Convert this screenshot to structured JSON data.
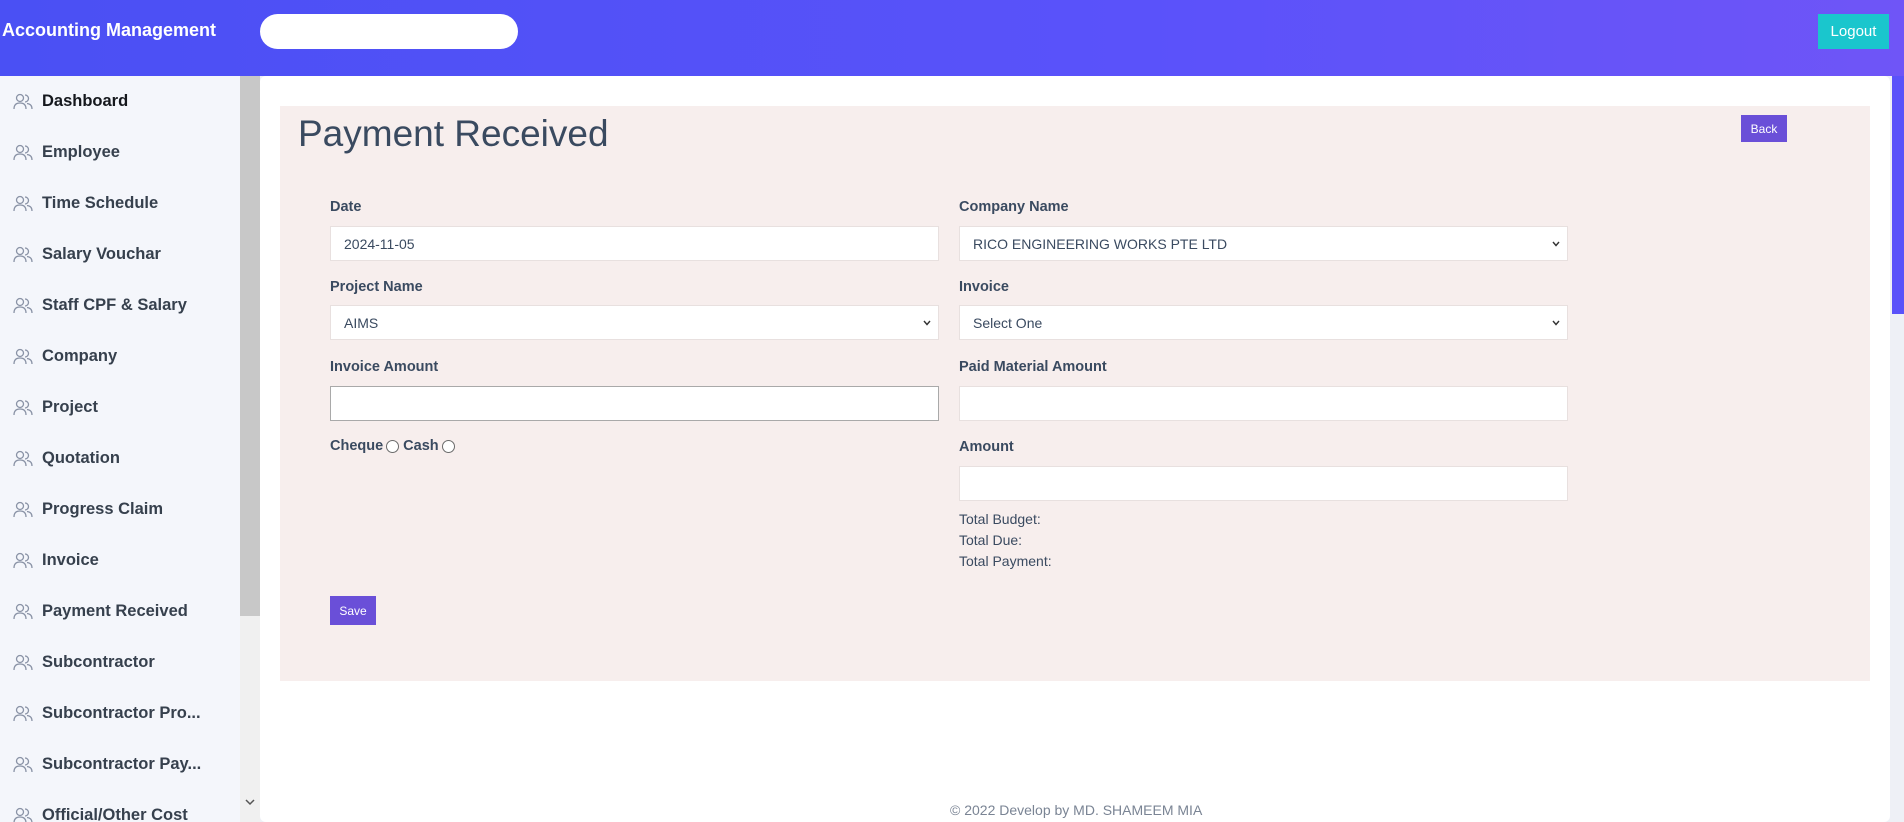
{
  "header": {
    "brand": "Accounting Management",
    "search_value": "",
    "logout_label": "Logout",
    "gradient_colors": [
      "#4a50f4",
      "#6f55f7"
    ]
  },
  "sidebar": {
    "items": [
      {
        "label": "Dashboard",
        "icon": "users-icon"
      },
      {
        "label": "Employee",
        "icon": "users-icon"
      },
      {
        "label": "Time Schedule",
        "icon": "users-icon"
      },
      {
        "label": "Salary Vouchar",
        "icon": "users-icon"
      },
      {
        "label": "Staff CPF & Salary",
        "icon": "users-icon"
      },
      {
        "label": "Company",
        "icon": "users-icon"
      },
      {
        "label": "Project",
        "icon": "users-icon"
      },
      {
        "label": "Quotation",
        "icon": "users-icon"
      },
      {
        "label": "Progress Claim",
        "icon": "users-icon"
      },
      {
        "label": "Invoice",
        "icon": "users-icon"
      },
      {
        "label": "Payment Received",
        "icon": "users-icon"
      },
      {
        "label": "Subcontractor",
        "icon": "users-icon"
      },
      {
        "label": "Subcontractor Pro...",
        "icon": "users-icon"
      },
      {
        "label": "Subcontractor Pay...",
        "icon": "users-icon"
      },
      {
        "label": "Official/Other Cost",
        "icon": "users-icon"
      }
    ]
  },
  "page": {
    "title": "Payment Received",
    "back_label": "Back",
    "accent_color": "#6a4fd8"
  },
  "form": {
    "date": {
      "label": "Date",
      "value": "2024-11-05"
    },
    "company_name": {
      "label": "Company Name",
      "value": "RICO ENGINEERING WORKS PTE LTD"
    },
    "project_name": {
      "label": "Project Name",
      "value": "AIMS"
    },
    "invoice": {
      "label": "Invoice",
      "value": "Select One"
    },
    "invoice_amount": {
      "label": "Invoice Amount",
      "value": ""
    },
    "paid_material_amount": {
      "label": "Paid Material Amount",
      "value": ""
    },
    "payment_methods": {
      "cheque": "Cheque",
      "cash": "Cash"
    },
    "amount": {
      "label": "Amount",
      "value": ""
    },
    "totals": {
      "total_budget": "Total Budget:",
      "total_due": "Total Due:",
      "total_payment": "Total Payment:"
    },
    "save_label": "Save"
  },
  "footer": {
    "text": "© 2022 Develop by MD. SHAMEEM MIA"
  }
}
